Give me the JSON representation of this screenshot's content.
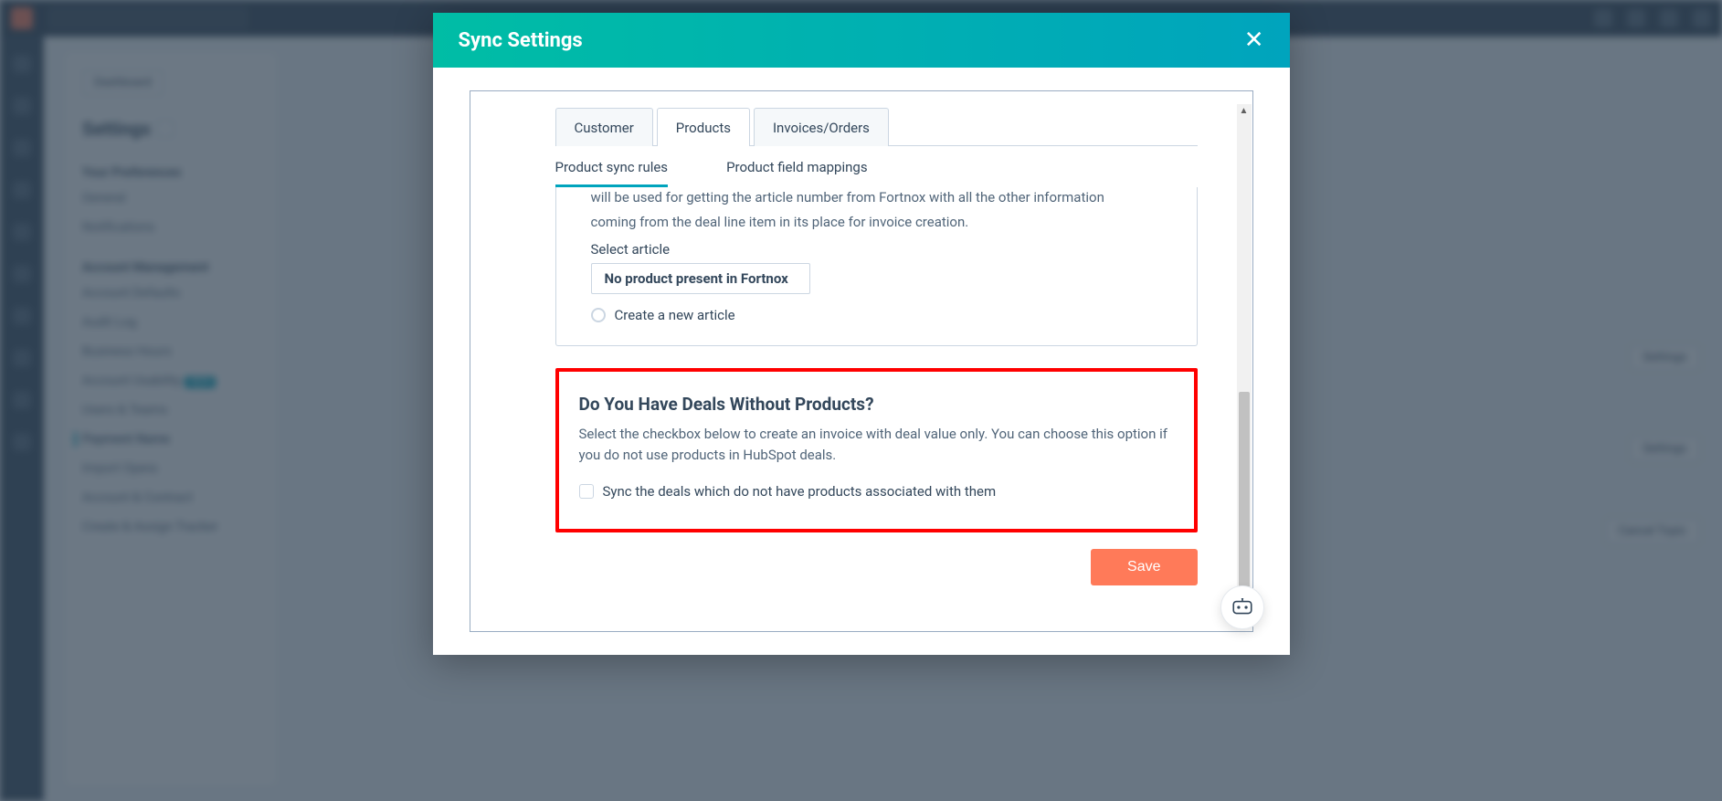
{
  "modal": {
    "title": "Sync Settings",
    "tabs": {
      "customer": "Customer",
      "products": "Products",
      "invoices": "Invoices/Orders"
    },
    "subtabs": {
      "rules": "Product sync rules",
      "mappings": "Product field mappings"
    },
    "truncated_line1": "will be used for getting the article number from Fortnox with all the other information",
    "truncated_line2": "coming from the deal line item in its place for invoice creation.",
    "select_label": "Select article",
    "select_value": "No product present in Fortnox",
    "radio_new": "Create a new article",
    "deals_title": "Do You Have Deals Without Products?",
    "deals_desc": "Select the checkbox below to create an invoice with deal value only. You can choose this option if you do not use products in HubSpot deals.",
    "deals_checkbox": "Sync the deals which do not have products associated with them",
    "save": "Save"
  },
  "bg": {
    "dashboard": "Dashboard",
    "settings_h": "Settings",
    "group1": "Your Preferences",
    "g1a": "General",
    "g1b": "Notifications",
    "group2": "Account Management",
    "g2a": "Account Defaults",
    "g2b": "Audit Log",
    "g2c": "Business Hours",
    "g2d": "Account Usability",
    "g2badge": "NEW",
    "g2e": "Users & Teams",
    "g2f": "Payment Name",
    "g2g": "Import Opera",
    "g2h": "Account & Contract",
    "g2i": "Create & Assign Tracker",
    "rbtn1": "Settings",
    "rbtn2": "Settings",
    "rbtn3": "Cancel Topic"
  }
}
